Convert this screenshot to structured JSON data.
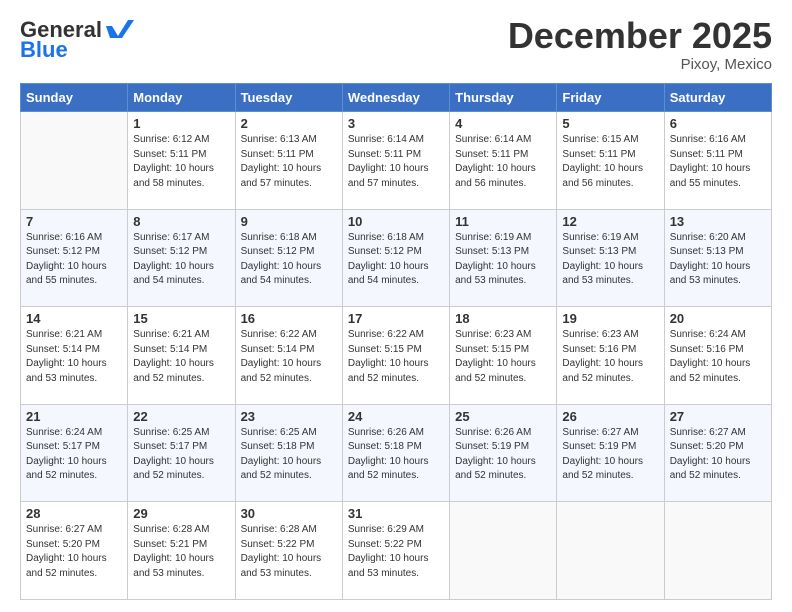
{
  "header": {
    "logo_text_general": "General",
    "logo_text_blue": "Blue",
    "month_title": "December 2025",
    "location": "Pixoy, Mexico"
  },
  "days_of_week": [
    "Sunday",
    "Monday",
    "Tuesday",
    "Wednesday",
    "Thursday",
    "Friday",
    "Saturday"
  ],
  "weeks": [
    [
      {
        "day": "",
        "info": ""
      },
      {
        "day": "1",
        "info": "Sunrise: 6:12 AM\nSunset: 5:11 PM\nDaylight: 10 hours\nand 58 minutes."
      },
      {
        "day": "2",
        "info": "Sunrise: 6:13 AM\nSunset: 5:11 PM\nDaylight: 10 hours\nand 57 minutes."
      },
      {
        "day": "3",
        "info": "Sunrise: 6:14 AM\nSunset: 5:11 PM\nDaylight: 10 hours\nand 57 minutes."
      },
      {
        "day": "4",
        "info": "Sunrise: 6:14 AM\nSunset: 5:11 PM\nDaylight: 10 hours\nand 56 minutes."
      },
      {
        "day": "5",
        "info": "Sunrise: 6:15 AM\nSunset: 5:11 PM\nDaylight: 10 hours\nand 56 minutes."
      },
      {
        "day": "6",
        "info": "Sunrise: 6:16 AM\nSunset: 5:11 PM\nDaylight: 10 hours\nand 55 minutes."
      }
    ],
    [
      {
        "day": "7",
        "info": "Sunrise: 6:16 AM\nSunset: 5:12 PM\nDaylight: 10 hours\nand 55 minutes."
      },
      {
        "day": "8",
        "info": "Sunrise: 6:17 AM\nSunset: 5:12 PM\nDaylight: 10 hours\nand 54 minutes."
      },
      {
        "day": "9",
        "info": "Sunrise: 6:18 AM\nSunset: 5:12 PM\nDaylight: 10 hours\nand 54 minutes."
      },
      {
        "day": "10",
        "info": "Sunrise: 6:18 AM\nSunset: 5:12 PM\nDaylight: 10 hours\nand 54 minutes."
      },
      {
        "day": "11",
        "info": "Sunrise: 6:19 AM\nSunset: 5:13 PM\nDaylight: 10 hours\nand 53 minutes."
      },
      {
        "day": "12",
        "info": "Sunrise: 6:19 AM\nSunset: 5:13 PM\nDaylight: 10 hours\nand 53 minutes."
      },
      {
        "day": "13",
        "info": "Sunrise: 6:20 AM\nSunset: 5:13 PM\nDaylight: 10 hours\nand 53 minutes."
      }
    ],
    [
      {
        "day": "14",
        "info": "Sunrise: 6:21 AM\nSunset: 5:14 PM\nDaylight: 10 hours\nand 53 minutes."
      },
      {
        "day": "15",
        "info": "Sunrise: 6:21 AM\nSunset: 5:14 PM\nDaylight: 10 hours\nand 52 minutes."
      },
      {
        "day": "16",
        "info": "Sunrise: 6:22 AM\nSunset: 5:14 PM\nDaylight: 10 hours\nand 52 minutes."
      },
      {
        "day": "17",
        "info": "Sunrise: 6:22 AM\nSunset: 5:15 PM\nDaylight: 10 hours\nand 52 minutes."
      },
      {
        "day": "18",
        "info": "Sunrise: 6:23 AM\nSunset: 5:15 PM\nDaylight: 10 hours\nand 52 minutes."
      },
      {
        "day": "19",
        "info": "Sunrise: 6:23 AM\nSunset: 5:16 PM\nDaylight: 10 hours\nand 52 minutes."
      },
      {
        "day": "20",
        "info": "Sunrise: 6:24 AM\nSunset: 5:16 PM\nDaylight: 10 hours\nand 52 minutes."
      }
    ],
    [
      {
        "day": "21",
        "info": "Sunrise: 6:24 AM\nSunset: 5:17 PM\nDaylight: 10 hours\nand 52 minutes."
      },
      {
        "day": "22",
        "info": "Sunrise: 6:25 AM\nSunset: 5:17 PM\nDaylight: 10 hours\nand 52 minutes."
      },
      {
        "day": "23",
        "info": "Sunrise: 6:25 AM\nSunset: 5:18 PM\nDaylight: 10 hours\nand 52 minutes."
      },
      {
        "day": "24",
        "info": "Sunrise: 6:26 AM\nSunset: 5:18 PM\nDaylight: 10 hours\nand 52 minutes."
      },
      {
        "day": "25",
        "info": "Sunrise: 6:26 AM\nSunset: 5:19 PM\nDaylight: 10 hours\nand 52 minutes."
      },
      {
        "day": "26",
        "info": "Sunrise: 6:27 AM\nSunset: 5:19 PM\nDaylight: 10 hours\nand 52 minutes."
      },
      {
        "day": "27",
        "info": "Sunrise: 6:27 AM\nSunset: 5:20 PM\nDaylight: 10 hours\nand 52 minutes."
      }
    ],
    [
      {
        "day": "28",
        "info": "Sunrise: 6:27 AM\nSunset: 5:20 PM\nDaylight: 10 hours\nand 52 minutes."
      },
      {
        "day": "29",
        "info": "Sunrise: 6:28 AM\nSunset: 5:21 PM\nDaylight: 10 hours\nand 53 minutes."
      },
      {
        "day": "30",
        "info": "Sunrise: 6:28 AM\nSunset: 5:22 PM\nDaylight: 10 hours\nand 53 minutes."
      },
      {
        "day": "31",
        "info": "Sunrise: 6:29 AM\nSunset: 5:22 PM\nDaylight: 10 hours\nand 53 minutes."
      },
      {
        "day": "",
        "info": ""
      },
      {
        "day": "",
        "info": ""
      },
      {
        "day": "",
        "info": ""
      }
    ]
  ]
}
